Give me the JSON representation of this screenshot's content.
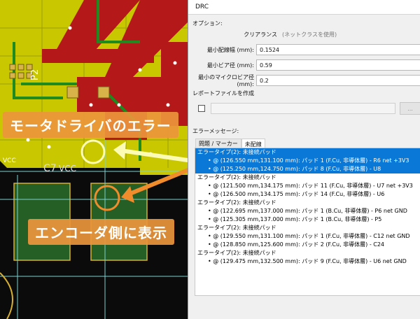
{
  "pcb": {
    "labels": {
      "vcc": "VCC",
      "p2": "P2",
      "c7": "C7",
      "vcc2": "VCC"
    }
  },
  "callouts": {
    "driver_error": "モータドライバのエラー",
    "encoder_side": "エンコーダ側に表示"
  },
  "drc": {
    "title": "DRC",
    "options_label": "オプション:",
    "clearance_label": "クリアランス",
    "clearance_value": "(ネットクラスを使用)",
    "min_track_width_label": "最小配線幅 (mm):",
    "min_track_width_value": "0.1524",
    "min_via_label": "最小ビア径 (mm):",
    "min_via_value": "0.59",
    "min_microvia_label": "最小のマイクロビア径 (mm):",
    "min_microvia_value": "0.2",
    "report_label": "レポートファイルを作成",
    "browse_label": "...",
    "messages_label": "エラーメッセージ:",
    "tabs": [
      {
        "label": "問題 / マーカー"
      },
      {
        "label": "未配線"
      }
    ],
    "errors": [
      {
        "type": "エラータイプ(2): 未接続パッド",
        "items": [
          "@ (126.550 mm,131.100 mm): パッド 1 (F.Cu, 非導体層) - R6 net +3V3",
          "@ (125.250 mm,124.750 mm): パッド 8 (F.Cu, 非導体層) - U8"
        ]
      },
      {
        "type": "エラータイプ(2): 未接続パッド",
        "items": [
          "@ (121.500 mm,134.175 mm): パッド 11 (F.Cu, 非導体層) - U7 net +3V3",
          "@ (126.500 mm,134.175 mm): パッド 14 (F.Cu, 非導体層) - U6"
        ]
      },
      {
        "type": "エラータイプ(2): 未接続パッド",
        "items": [
          "@ (122.695 mm,137.000 mm): パッド 1 (B.Cu, 非導体層) - P6 net GND",
          "@ (125.305 mm,137.000 mm): パッド 1 (B.Cu, 非導体層) - P5"
        ]
      },
      {
        "type": "エラータイプ(2): 未接続パッド",
        "items": [
          "@ (129.550 mm,131.100 mm): パッド 1 (F.Cu, 非導体層) - C12 net GND",
          "@ (128.850 mm,125.600 mm): パッド 2 (F.Cu, 非導体層) - C24"
        ]
      },
      {
        "type": "エラータイプ(2): 未接続パッド",
        "items": [
          "@ (129.475 mm,132.500 mm): パッド 9 (F.Cu, 非導体層) - U6 net GND"
        ]
      }
    ]
  }
}
